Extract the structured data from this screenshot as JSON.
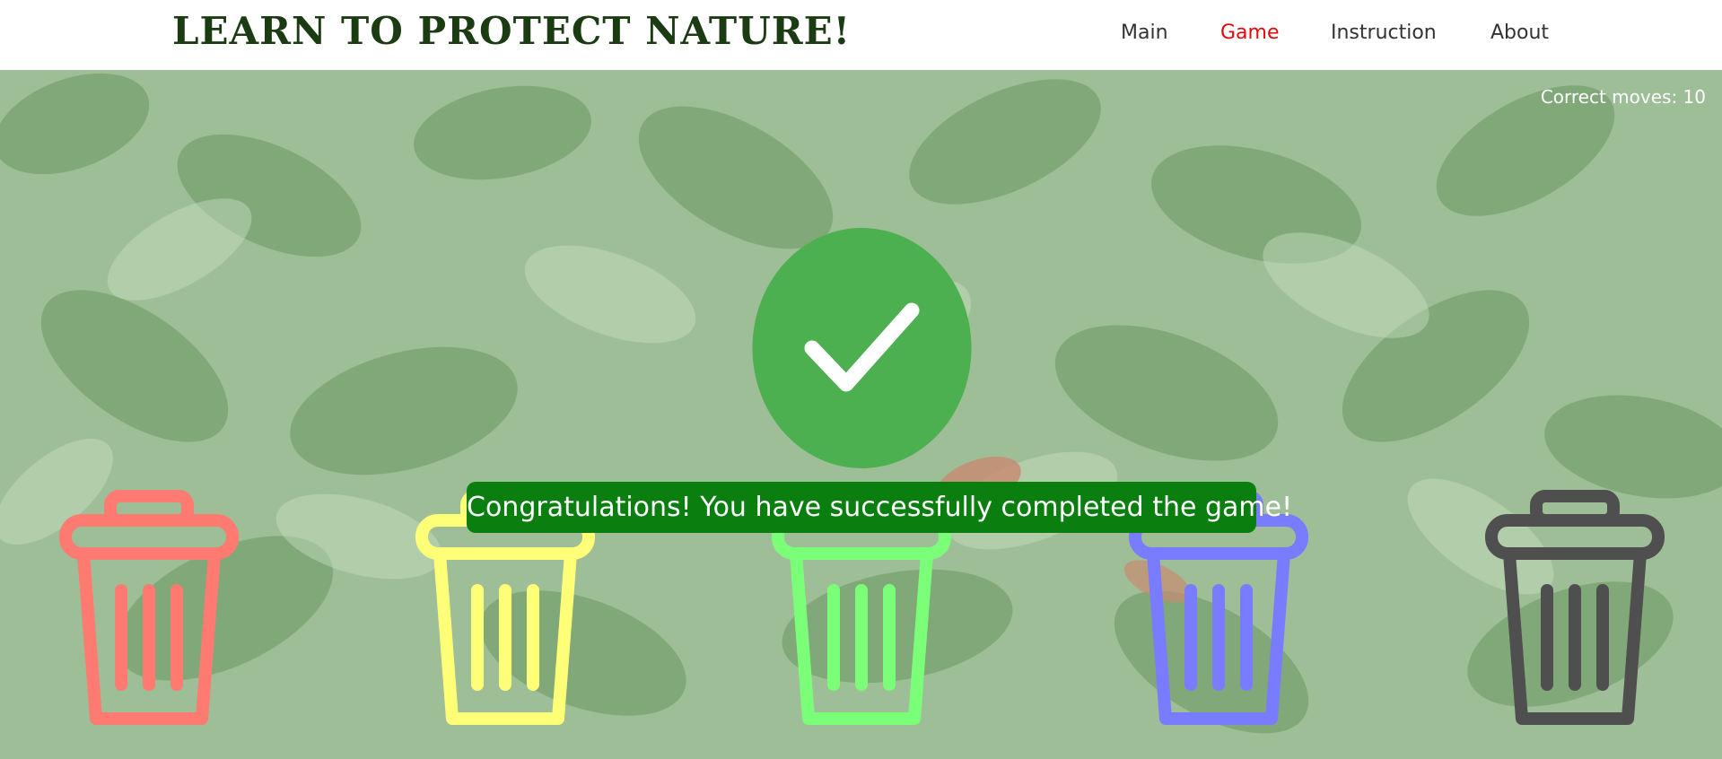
{
  "header": {
    "title": "LEARN TO PROTECT NATURE!",
    "nav": [
      {
        "label": "Main",
        "active": false
      },
      {
        "label": "Game",
        "active": true
      },
      {
        "label": "Instruction",
        "active": false
      },
      {
        "label": "About",
        "active": false
      }
    ]
  },
  "game": {
    "correct_moves": "Correct moves: 10",
    "success_icon": "check-circle-icon",
    "message": "Congratulations! You have successfully completed the game!",
    "bins": [
      {
        "icon": "trash-bin-icon",
        "color": "#ff7a70"
      },
      {
        "icon": "trash-bin-icon",
        "color": "#ffff78"
      },
      {
        "icon": "trash-bin-icon",
        "color": "#7cff78"
      },
      {
        "icon": "trash-bin-icon",
        "color": "#7a7cff"
      },
      {
        "icon": "trash-bin-icon",
        "color": "#4f4f4f"
      }
    ]
  },
  "colors": {
    "header_bg": "#ffffff",
    "title": "#1b3b12",
    "nav_active": "#e30a0a",
    "success_green": "#4caf50",
    "banner_bg": "#0a7f10"
  }
}
